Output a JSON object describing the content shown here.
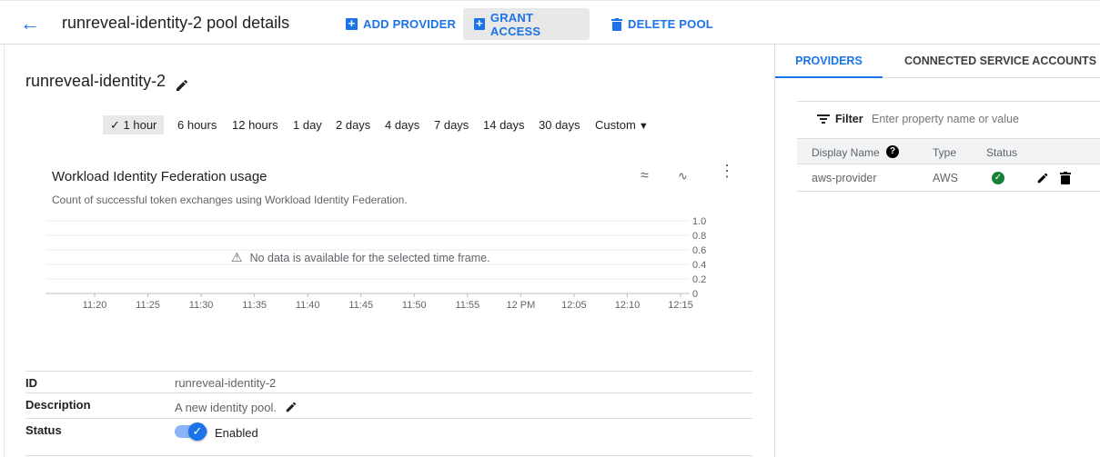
{
  "header": {
    "title": "runreveal-identity-2 pool details",
    "add_provider": "ADD PROVIDER",
    "grant_access": "GRANT ACCESS",
    "delete_pool": "DELETE POOL"
  },
  "pool": {
    "name": "runreveal-identity-2"
  },
  "time_ranges": [
    "1 hour",
    "6 hours",
    "12 hours",
    "1 day",
    "2 days",
    "4 days",
    "7 days",
    "14 days",
    "30 days",
    "Custom"
  ],
  "selected_range": "1 hour",
  "chart_data": {
    "type": "line",
    "title": "Workload Identity Federation usage",
    "subtitle": "Count of successful token exchanges using Workload Identity Federation.",
    "empty_message": "No data is available for the selected time frame.",
    "x_ticks": [
      "11:20",
      "11:25",
      "11:30",
      "11:35",
      "11:40",
      "11:45",
      "11:50",
      "11:55",
      "12 PM",
      "12:05",
      "12:10",
      "12:15"
    ],
    "y_ticks": [
      "1.0",
      "0.8",
      "0.6",
      "0.4",
      "0.2",
      "0"
    ],
    "ylim": [
      0,
      1
    ],
    "grid": true,
    "series": []
  },
  "details": [
    {
      "label": "ID",
      "value": "runreveal-identity-2"
    },
    {
      "label": "Description",
      "value": "A new identity pool."
    },
    {
      "label": "Status",
      "value": "Enabled"
    }
  ],
  "right": {
    "tabs": [
      "PROVIDERS",
      "CONNECTED SERVICE ACCOUNTS"
    ],
    "filter_label": "Filter",
    "filter_placeholder": "Enter property name or value",
    "columns": [
      "Display Name",
      "Type",
      "Status"
    ],
    "rows": [
      {
        "name": "aws-provider",
        "type": "AWS",
        "status": "ok"
      }
    ]
  },
  "colors": {
    "accent": "#1a73e8",
    "success": "#188038"
  }
}
